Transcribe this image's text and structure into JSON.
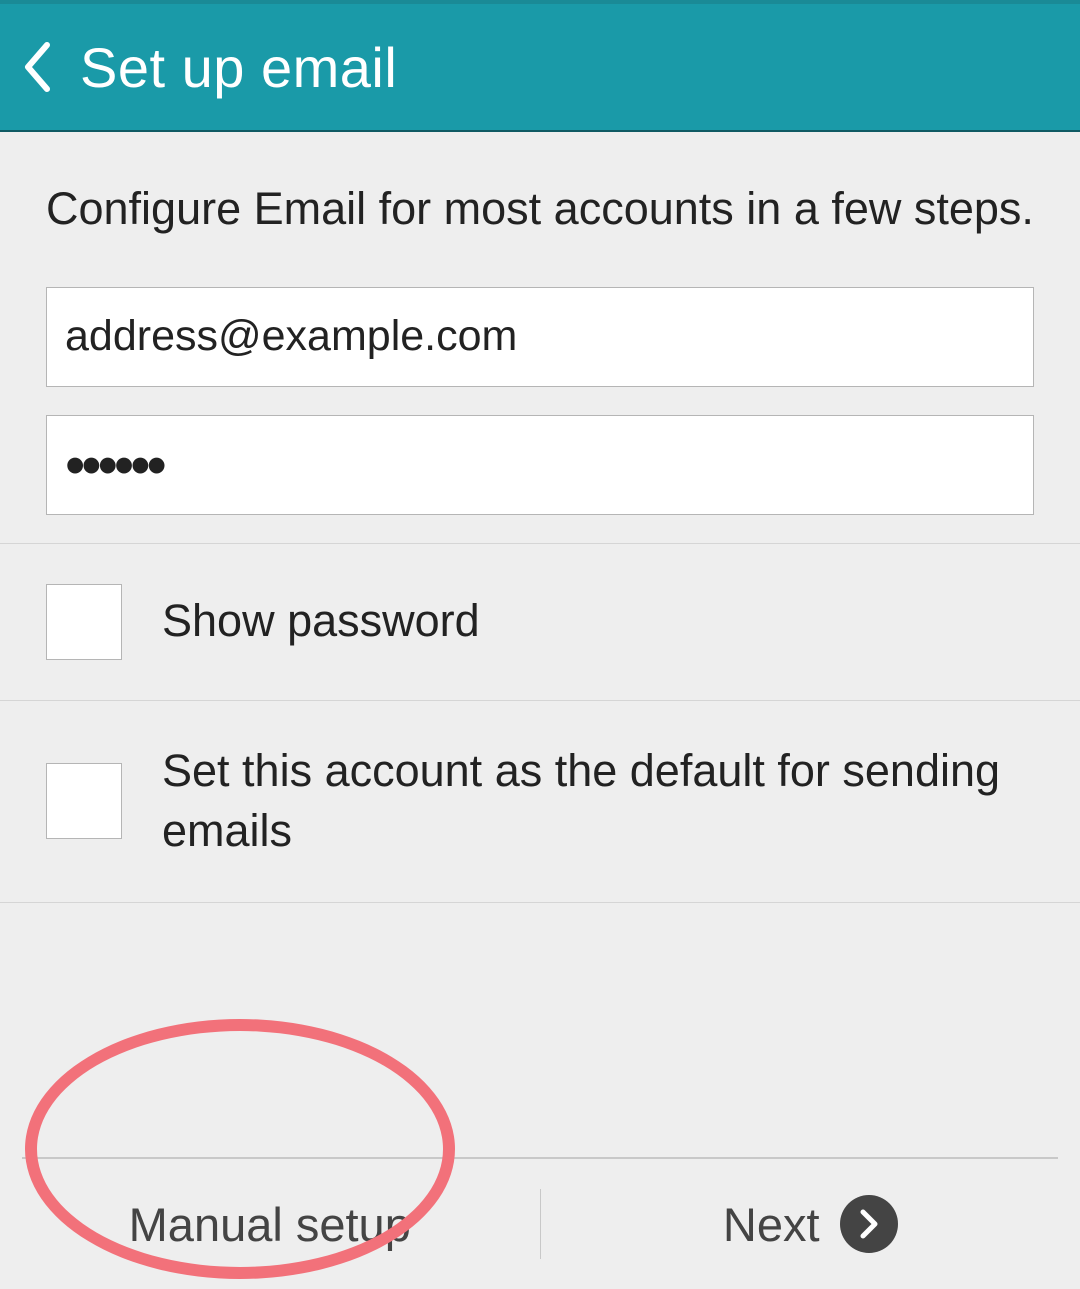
{
  "header": {
    "title": "Set up email"
  },
  "instruction": "Configure Email for most accounts in a few steps.",
  "fields": {
    "email_value": "address@example.com",
    "password_mask": "••••••"
  },
  "options": {
    "show_password_label": "Show password",
    "default_account_label": "Set this account as the default for sending emails"
  },
  "footer": {
    "manual_setup_label": "Manual setup",
    "next_label": "Next"
  }
}
